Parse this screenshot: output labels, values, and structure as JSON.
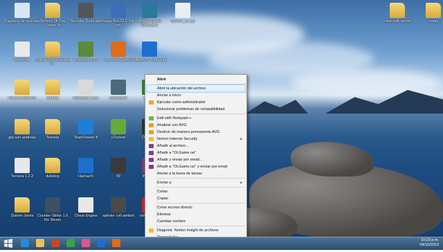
{
  "desktop": {
    "icons": [
      {
        "label": "Papelera de reciclaje",
        "kind": "recycle-bin",
        "color": "#d8e6f2"
      },
      {
        "label": "Technic Of The Chaos III",
        "kind": "folder",
        "color": "#e8b84a"
      },
      {
        "label": "Servidor Dedicado",
        "kind": "app",
        "color": "#555555"
      },
      {
        "label": "Vegas Pro 12.0 (64-bit)",
        "kind": "app",
        "color": "#3c6fb5"
      },
      {
        "label": "Mobile Media Converter",
        "kind": "app",
        "color": "#2a7a9a"
      },
      {
        "label": "DEWO_11.zip",
        "kind": "file",
        "color": "#e9eef5"
      },
      {
        "label": "minecraft server",
        "kind": "folder",
        "color": "#e8b84a"
      },
      {
        "label": "cosas",
        "kind": "folder",
        "color": "#e8b84a"
      },
      {
        "label": "minecraft",
        "kind": "file",
        "color": "#e8e8e8"
      },
      {
        "label": "Splinter Cell Pandora T...",
        "kind": "folder",
        "color": "#e8b84a"
      },
      {
        "label": "Minecraft 1.5.2",
        "kind": "app",
        "color": "#5b8a3a"
      },
      {
        "label": "uTorrent Catcher",
        "kind": "app",
        "color": "#e06b1a"
      },
      {
        "label": "DAEMON Tools Lite",
        "kind": "app",
        "color": "#1f6fcf"
      },
      {
        "label": "Planet Explorers",
        "kind": "folder",
        "color": "#e8b84a"
      },
      {
        "label": "Outlast",
        "kind": "folder",
        "color": "#e8b84a"
      },
      {
        "label": "Minecraft 1.6.4",
        "kind": "app",
        "color": "#d9d9d9"
      },
      {
        "label": "DeadZone",
        "kind": "app",
        "color": "#4a6a7a"
      },
      {
        "label": "Terraria",
        "kind": "app",
        "color": "#3a7a3a"
      },
      {
        "label": "gta san andreas",
        "kind": "folder",
        "color": "#e8b84a"
      },
      {
        "label": "Terraria",
        "kind": "folder",
        "color": "#e8b84a"
      },
      {
        "label": "TeamViewer 8",
        "kind": "app",
        "color": "#1f7fd6"
      },
      {
        "label": "uTorrent",
        "kind": "app",
        "color": "#67a93a"
      },
      {
        "label": "OLGame",
        "kind": "app",
        "color": "#2b3a2b"
      },
      {
        "label": "Terraria 1.2.2",
        "kind": "file",
        "color": "#e8e8e8"
      },
      {
        "label": "dubstep",
        "kind": "folder",
        "color": "#e8b84a"
      },
      {
        "label": "Hamachi",
        "kind": "app",
        "color": "#1d6fd0"
      },
      {
        "label": "99",
        "kind": "app",
        "color": "#3a3a3a"
      },
      {
        "label": "WinRAR",
        "kind": "app",
        "color": "#8a3a7a"
      },
      {
        "label": "Sistem Jarvis",
        "kind": "folder",
        "color": "#e8b84a"
      },
      {
        "label": "Counter-Strike 1.6 No Steam",
        "kind": "app",
        "color": "#3d4f63"
      },
      {
        "label": "Cheat Engine",
        "kind": "app",
        "color": "#e8e8e8"
      },
      {
        "label": "splinter cell aimbot",
        "kind": "app",
        "color": "#4a4a4a"
      },
      {
        "label": "video_2013",
        "kind": "app",
        "color": "#c82a2a"
      }
    ]
  },
  "context_menu": {
    "items": [
      {
        "label": "Abrir",
        "icon": "",
        "bold": true,
        "submenu": false,
        "highlighted": false
      },
      {
        "label": "Abrir la ubicación del archivo",
        "icon": "",
        "bold": false,
        "submenu": false,
        "highlighted": true
      },
      {
        "label": "Anclar a Inicio",
        "icon": "",
        "bold": false,
        "submenu": false,
        "highlighted": false
      },
      {
        "label": "Ejecutar como administrador",
        "icon": "shield-icon",
        "bold": false,
        "submenu": false,
        "highlighted": false
      },
      {
        "label": "Solucionar problemas de compatibilidad",
        "icon": "",
        "bold": false,
        "submenu": false,
        "highlighted": false
      },
      {
        "label": "Edit with Notepad++",
        "icon": "notepad-icon",
        "bold": false,
        "submenu": false,
        "highlighted": false
      },
      {
        "label": "Analizar con AVG",
        "icon": "avg-icon",
        "bold": false,
        "submenu": false,
        "highlighted": false
      },
      {
        "label": "Destruir de manera permanente AVG",
        "icon": "avg-icon",
        "bold": false,
        "submenu": false,
        "highlighted": false
      },
      {
        "label": "Norton Internet Security",
        "icon": "norton-icon",
        "bold": false,
        "submenu": true,
        "highlighted": false
      },
      {
        "label": "Añadir al archivo...",
        "icon": "winrar-icon",
        "bold": false,
        "submenu": false,
        "highlighted": false
      },
      {
        "label": "Añadir a \"OLGame.rar\"",
        "icon": "winrar-icon",
        "bold": false,
        "submenu": false,
        "highlighted": false
      },
      {
        "label": "Añadir y enviar por email...",
        "icon": "winrar-icon",
        "bold": false,
        "submenu": false,
        "highlighted": false
      },
      {
        "label": "Añadir a \"OLGame.rar\" y enviar por email",
        "icon": "winrar-icon",
        "bold": false,
        "submenu": false,
        "highlighted": false
      },
      {
        "label": "Anclar a la barra de tareas",
        "icon": "",
        "bold": false,
        "submenu": false,
        "highlighted": false
      },
      {
        "label": "Enviar a",
        "icon": "",
        "bold": false,
        "submenu": true,
        "highlighted": false
      },
      {
        "label": "Cortar",
        "icon": "",
        "bold": false,
        "submenu": false,
        "highlighted": false
      },
      {
        "label": "Copiar",
        "icon": "",
        "bold": false,
        "submenu": false,
        "highlighted": false
      },
      {
        "label": "Crear acceso directo",
        "icon": "",
        "bold": false,
        "submenu": false,
        "highlighted": false
      },
      {
        "label": "Eliminar",
        "icon": "",
        "bold": false,
        "submenu": false,
        "highlighted": false
      },
      {
        "label": "Cambiar nombre",
        "icon": "",
        "bold": false,
        "submenu": false,
        "highlighted": false
      },
      {
        "label": "Diagnóst. Norton Insight de archivos",
        "icon": "norton-icon",
        "bold": false,
        "submenu": false,
        "highlighted": false
      },
      {
        "label": "Propiedades",
        "icon": "",
        "bold": false,
        "submenu": false,
        "highlighted": false
      }
    ],
    "submenu_glyph": "▸"
  },
  "taskbar": {
    "apps": [
      {
        "name": "internet-explorer",
        "color": "#2a8ad8"
      },
      {
        "name": "file-explorer",
        "color": "#e8c25a"
      },
      {
        "name": "color-app",
        "color": "#c8452a"
      },
      {
        "name": "windows-store",
        "color": "#3ba24a"
      },
      {
        "name": "media-app",
        "color": "#d85a8a"
      },
      {
        "name": "hp-app",
        "color": "#1f6fd0"
      },
      {
        "name": "utorrent-catcher",
        "color": "#e06b1a"
      }
    ],
    "clock_time": "10:23 p.m.",
    "clock_date": "04/10/2013"
  }
}
